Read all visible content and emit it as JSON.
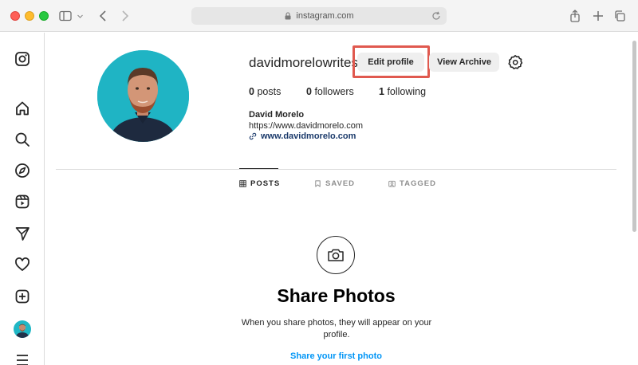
{
  "browser": {
    "url": "instagram.com",
    "icons": [
      "sidebar-toggle-icon",
      "chevron-down-icon",
      "back-icon",
      "forward-icon",
      "lock-icon",
      "reload-icon",
      "share-icon",
      "new-tab-icon",
      "tabs-overview-icon"
    ]
  },
  "sidebar": {
    "items": [
      {
        "name": "instagram-logo-icon"
      },
      {
        "name": "home-icon"
      },
      {
        "name": "search-icon"
      },
      {
        "name": "explore-icon"
      },
      {
        "name": "reels-icon"
      },
      {
        "name": "messages-icon"
      },
      {
        "name": "notifications-icon"
      },
      {
        "name": "create-icon"
      },
      {
        "name": "profile-avatar"
      },
      {
        "name": "more-menu-icon"
      }
    ]
  },
  "profile": {
    "username": "davidmorelowrites",
    "edit_label": "Edit profile",
    "archive_label": "View Archive",
    "stats": {
      "posts_count": "0",
      "posts_label": "posts",
      "followers_count": "0",
      "followers_label": "followers",
      "following_count": "1",
      "following_label": "following"
    },
    "full_name": "David Morelo",
    "bio": "https://www.davidmorelo.com",
    "website": "www.davidmorelo.com"
  },
  "tabs": [
    {
      "label": "POSTS",
      "icon": "grid-icon",
      "active": true
    },
    {
      "label": "SAVED",
      "icon": "bookmark-icon",
      "active": false
    },
    {
      "label": "TAGGED",
      "icon": "tagged-icon",
      "active": false
    }
  ],
  "empty_state": {
    "icon": "camera-icon",
    "title": "Share Photos",
    "description": "When you share photos, they will appear on your profile.",
    "link": "Share your first photo"
  },
  "colors": {
    "highlight": "#e0594f",
    "link": "#0095f6",
    "avatar_bg": "#1fb4c4"
  }
}
